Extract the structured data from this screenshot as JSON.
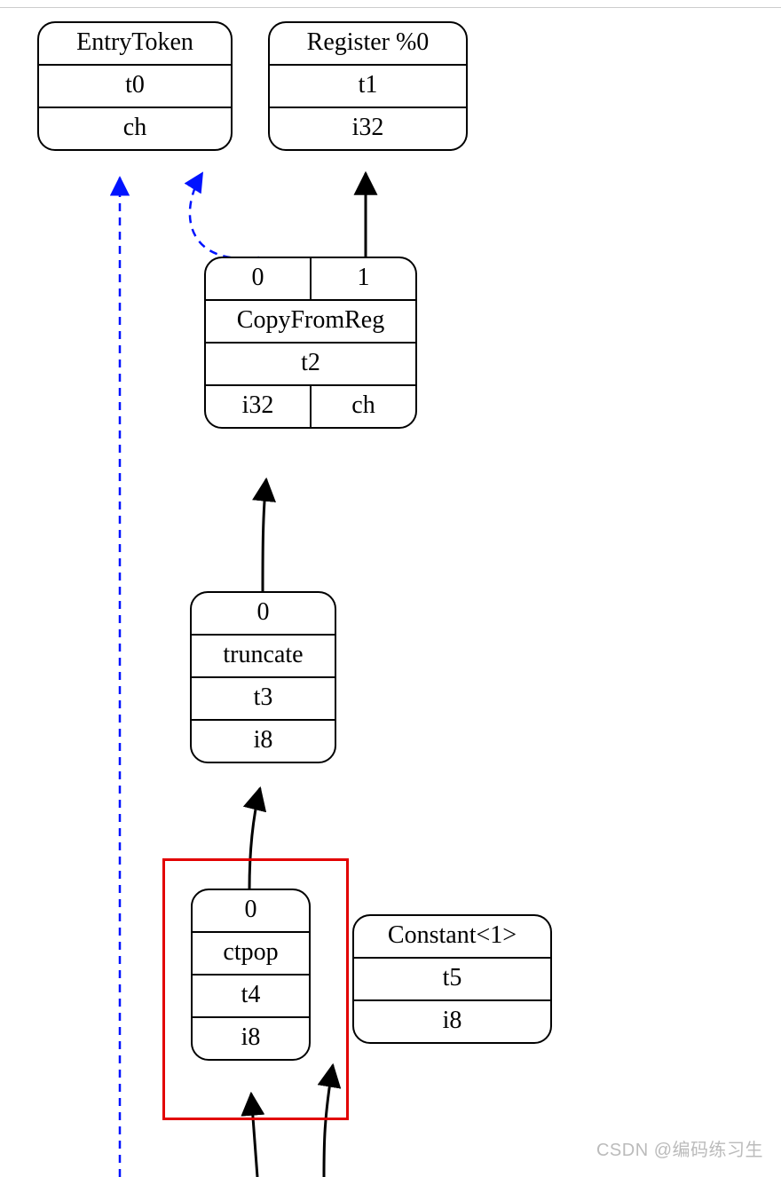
{
  "nodes": {
    "entry": {
      "title": "EntryToken",
      "id": "t0",
      "type": "ch"
    },
    "register": {
      "title": "Register %0",
      "id": "t1",
      "type": "i32"
    },
    "copyfromreg": {
      "in0": "0",
      "in1": "1",
      "op": "CopyFromReg",
      "id": "t2",
      "out0": "i32",
      "out1": "ch"
    },
    "truncate": {
      "in0": "0",
      "op": "truncate",
      "id": "t3",
      "type": "i8"
    },
    "ctpop": {
      "in0": "0",
      "op": "ctpop",
      "id": "t4",
      "type": "i8"
    },
    "constant": {
      "title": "Constant<1>",
      "id": "t5",
      "type": "i8"
    }
  },
  "highlight": {
    "target": "ctpop",
    "color": "#e20000"
  },
  "edges": [
    {
      "from": "copyfromreg.in0",
      "to": "entry.type",
      "style": "dashed-blue"
    },
    {
      "from": "copyfromreg.in1",
      "to": "register.type",
      "style": "solid-black"
    },
    {
      "from": "truncate.in0",
      "to": "copyfromreg.out0",
      "style": "solid-black"
    },
    {
      "from": "ctpop.in0",
      "to": "truncate.type",
      "style": "solid-black"
    },
    {
      "from": "offscreen",
      "to": "entry.type",
      "style": "dashed-blue"
    },
    {
      "from": "offscreen",
      "to": "ctpop.type",
      "style": "solid-black"
    },
    {
      "from": "offscreen",
      "to": "constant.type",
      "style": "solid-black"
    }
  ],
  "watermark": "CSDN @编码练习生"
}
